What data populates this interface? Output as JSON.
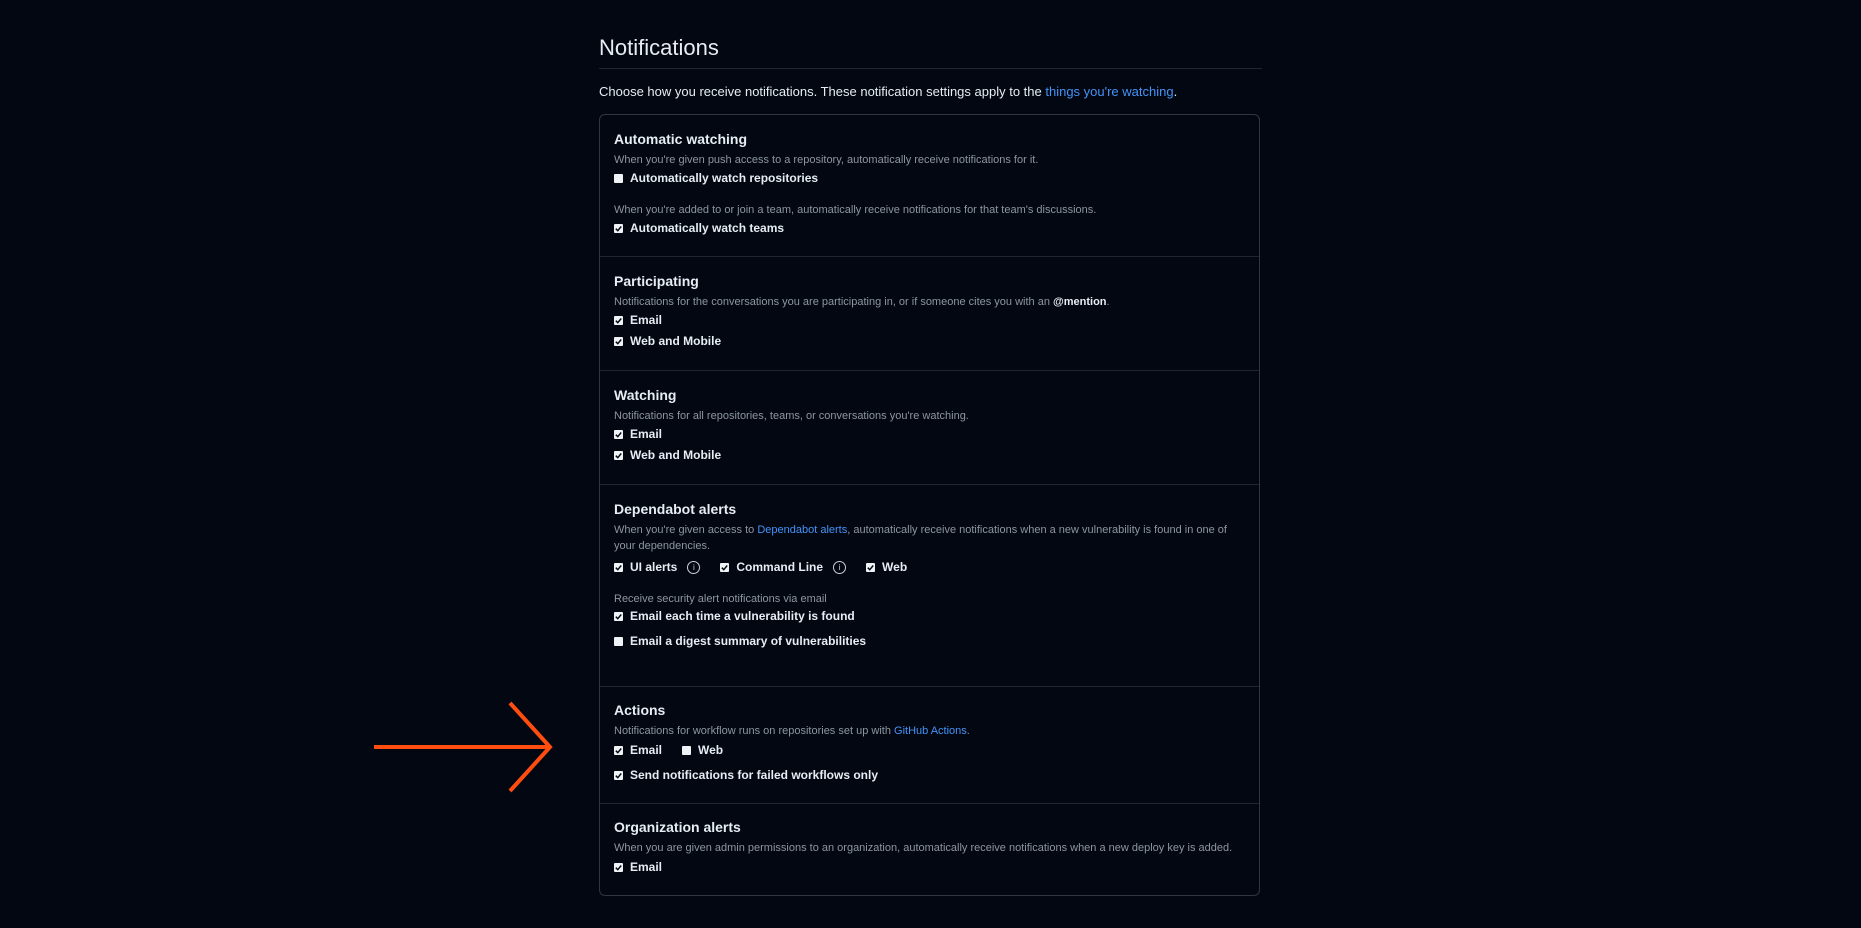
{
  "page": {
    "title": "Notifications",
    "intro_prefix": "Choose how you receive notifications. These notification settings apply to the ",
    "intro_link": "things you're watching",
    "intro_suffix": "."
  },
  "sections": {
    "auto_watching": {
      "title": "Automatic watching",
      "desc1": "When you're given push access to a repository, automatically receive notifications for it.",
      "repo_label": "Automatically watch repositories",
      "repo_checked": false,
      "desc2": "When you're added to or join a team, automatically receive notifications for that team's discussions.",
      "teams_label": "Automatically watch teams",
      "teams_checked": true
    },
    "participating": {
      "title": "Participating",
      "desc_prefix": "Notifications for the conversations you are participating in, or if someone cites you with an ",
      "desc_mention": "@mention",
      "desc_suffix": ".",
      "email_label": "Email",
      "web_label": "Web and Mobile"
    },
    "watching": {
      "title": "Watching",
      "desc": "Notifications for all repositories, teams, or conversations you're watching.",
      "email_label": "Email",
      "web_label": "Web and Mobile"
    },
    "dependabot": {
      "title": "Dependabot alerts",
      "desc_prefix": "When you're given access to ",
      "desc_link": "Dependabot alerts",
      "desc_suffix": ", automatically receive notifications when a new vulnerability is found in one of your dependencies.",
      "ui_label": "UI alerts",
      "cli_label": "Command Line",
      "web_label": "Web",
      "email_desc": "Receive security alert notifications via email",
      "each_label": "Email each time a vulnerability is found",
      "digest_label": "Email a digest summary of vulnerabilities"
    },
    "actions": {
      "title": "Actions",
      "desc_prefix": "Notifications for workflow runs on repositories set up with ",
      "desc_link": "GitHub Actions",
      "desc_suffix": ".",
      "email_label": "Email",
      "web_label": "Web",
      "failed_label": "Send notifications for failed workflows only"
    },
    "org_alerts": {
      "title": "Organization alerts",
      "desc": "When you are given admin permissions to an organization, automatically receive notifications when a new deploy key is added.",
      "email_label": "Email"
    }
  },
  "colors": {
    "arrow": "#ff4d0f",
    "link": "#4493f8",
    "background": "#030711"
  },
  "icons": {
    "info": "info-icon",
    "check": "check-icon",
    "arrow": "right-arrow-icon"
  }
}
